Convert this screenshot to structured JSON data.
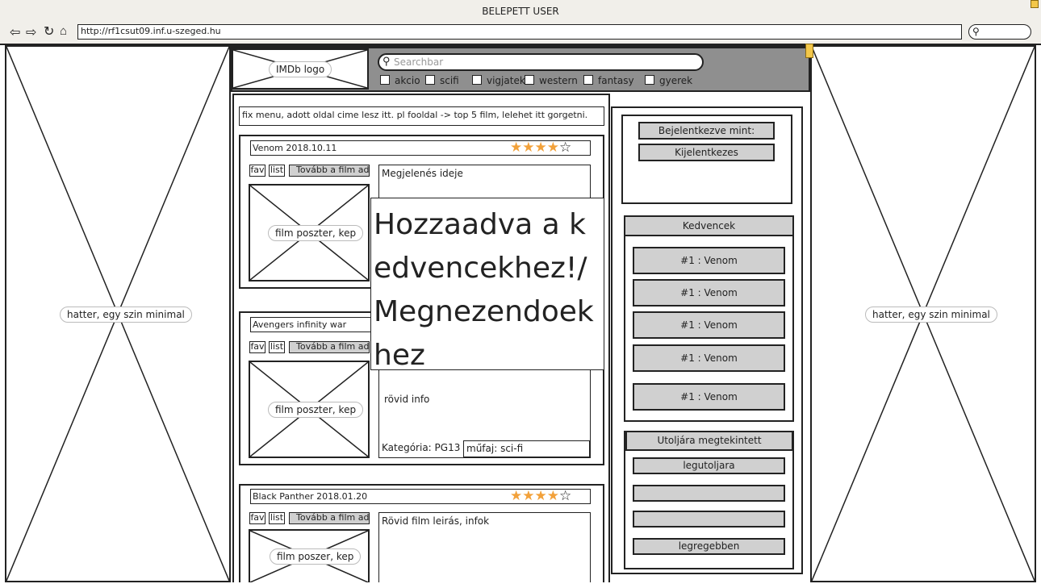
{
  "window": {
    "title": "BELEPETT USER",
    "url": "http://rf1csut09.inf.u-szeged.hu"
  },
  "background_label": "hatter, egy szin minimal",
  "header": {
    "logo_label": "IMDb logo",
    "search_placeholder": "Searchbar",
    "genres": [
      "akcio",
      "scifi",
      "vigjatek",
      "western",
      "fantasy",
      "gyerek"
    ]
  },
  "fix_menu_text": "fix menu, adott oldal cime lesz itt. pl fooldal -> top 5 film, lelehet itt gorgetni.",
  "movies": [
    {
      "title": "Venom 2018.10.11",
      "rating": 4,
      "fav": "fav",
      "list": "list",
      "more": "Tovább a film adatlapjára",
      "poster": "film poszter, kep",
      "description": "Megjelenés ideje"
    },
    {
      "title": "Avengers infinity war",
      "fav": "fav",
      "list": "list",
      "more": "Tovább a film adatlapjára",
      "poster": "film poszter, kep",
      "short_info": "rövid info",
      "category": "Kategória: PG13",
      "genre": "műfaj: sci-fi"
    },
    {
      "title": "Black Panther 2018.01.20",
      "rating": 4,
      "fav": "fav",
      "list": "list",
      "more": "Tovább a film adatlapjára",
      "poster": "film poszer, kep",
      "description": "Rövid film leirás, infok"
    }
  ],
  "popup": {
    "text": "Hozzaadva a kedvencekhez!/ Megnezendoekhez"
  },
  "sidebar": {
    "logged_in_as": "Bejelentkezve mint:",
    "logout": "Kijelentkezes",
    "favorites_title": "Kedvencek",
    "favorites": [
      "#1 : Venom",
      "#1 : Venom",
      "#1 : Venom",
      "#1 : Venom",
      "#1 : Venom"
    ],
    "recent_title": "Utoljára megtekintett",
    "recent": [
      "legutoljara",
      "",
      "",
      "legregebben"
    ]
  }
}
